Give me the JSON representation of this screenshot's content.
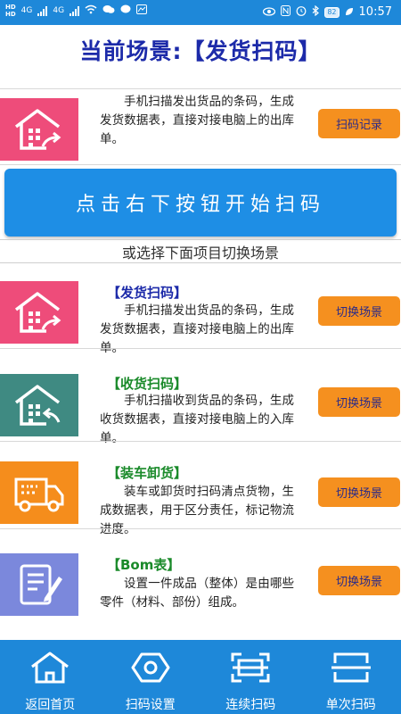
{
  "status_bar": {
    "hd1": "HD",
    "hd2": "HD",
    "net1": "4G",
    "net2": "4G",
    "battery": "82",
    "time": "10:57"
  },
  "header": {
    "title": "当前场景:【发货扫码】"
  },
  "current_scene": {
    "description": "手机扫描发出货品的条码，生成发货数据表，直接对接电脑上的出库单。",
    "button_label": "扫码记录",
    "icon_color": "#ee4c7a"
  },
  "start_button": {
    "label": "点击右下按钮开始扫码"
  },
  "section_label": "或选择下面项目切换场景",
  "scenes": [
    {
      "title": "【发货扫码】",
      "description": "手机扫描发出货品的条码，生成发货数据表，直接对接电脑上的出库单。",
      "button_label": "切换场景",
      "title_color": "#1c2aa9",
      "icon_color": "#ee4c7a"
    },
    {
      "title": "【收货扫码】",
      "description": "手机扫描收到货品的条码，生成收货数据表，直接对接电脑上的入库单。",
      "button_label": "切换场景",
      "title_color": "#1a8a2a",
      "icon_color": "#3f8a82"
    },
    {
      "title": "【装车卸货】",
      "description": "装车或卸货时扫码清点货物，生成数据表，用于区分责任，标记物流进度。",
      "button_label": "切换场景",
      "title_color": "#1a8a2a",
      "icon_color": "#f58d1c"
    },
    {
      "title": "【Bom表】",
      "description": "设置一件成品（整体）是由哪些零件（材料、部份）组成。",
      "button_label": "切换场景",
      "title_color": "#1a8a2a",
      "icon_color": "#7b88dc"
    }
  ],
  "bottom_nav": [
    {
      "label": "返回首页",
      "icon": "home-icon"
    },
    {
      "label": "扫码设置",
      "icon": "settings-hex-icon"
    },
    {
      "label": "连续扫码",
      "icon": "scan-frame-icon"
    },
    {
      "label": "单次扫码",
      "icon": "single-scan-icon"
    }
  ]
}
